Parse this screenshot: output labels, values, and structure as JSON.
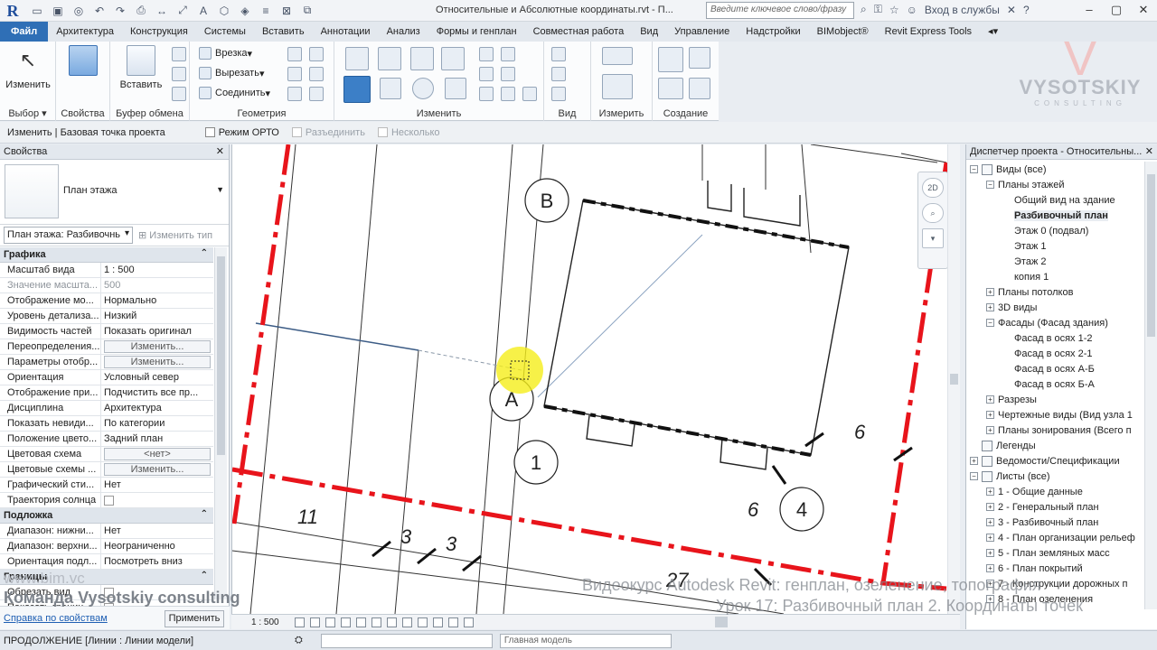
{
  "titlebar": {
    "app_logo": "R",
    "document_title": "Относительные и Абсолютные координаты.rvt - П...",
    "search_placeholder": "Введите ключевое слово/фразу",
    "signin_label": "Вход в службы"
  },
  "ribbon_tabs": [
    "Файл",
    "Архитектура",
    "Конструкция",
    "Системы",
    "Вставить",
    "Аннотации",
    "Анализ",
    "Формы и генплан",
    "Совместная работа",
    "Вид",
    "Управление",
    "Надстройки",
    "BIMobject®",
    "Revit Express Tools"
  ],
  "active_tab_index": 0,
  "ribbon": {
    "select": {
      "button": "Изменить",
      "label": "Выбор"
    },
    "properties": {
      "label": "Свойства"
    },
    "clipboard": {
      "button": "Вставить",
      "label": "Буфер обмена"
    },
    "geometry": {
      "cut": "Врезка",
      "cut_out": "Вырезать",
      "join": "Соединить",
      "label": "Геометрия"
    },
    "modify": {
      "label": "Изменить"
    },
    "view": {
      "label": "Вид"
    },
    "measure": {
      "label": "Измерить"
    },
    "create": {
      "label": "Создание"
    }
  },
  "brand_logo": {
    "mark": "V",
    "name": "VYSOTSKIY",
    "tagline": "CONSULTING"
  },
  "options_bar": {
    "context": "Изменить | Базовая точка проекта",
    "options": [
      {
        "label": "Режим ОРТО",
        "enabled": true
      },
      {
        "label": "Разъединить",
        "enabled": false
      },
      {
        "label": "Несколько",
        "enabled": false
      }
    ]
  },
  "properties": {
    "title": "Свойства",
    "type_name": "План этажа",
    "instance_selector": "План этажа: Разбивочнь",
    "edit_type": "Изменить тип",
    "sections": [
      {
        "name": "Графика",
        "rows": [
          {
            "key": "Масштаб вида",
            "value": "1 : 500",
            "kind": "text"
          },
          {
            "key": "Значение масшта...",
            "value": "500",
            "kind": "dim"
          },
          {
            "key": "Отображение мо...",
            "value": "Нормально",
            "kind": "text"
          },
          {
            "key": "Уровень детализа...",
            "value": "Низкий",
            "kind": "text"
          },
          {
            "key": "Видимость частей",
            "value": "Показать оригинал",
            "kind": "text"
          },
          {
            "key": "Переопределения...",
            "value": "Изменить...",
            "kind": "button"
          },
          {
            "key": "Параметры отобр...",
            "value": "Изменить...",
            "kind": "button"
          },
          {
            "key": "Ориентация",
            "value": "Условный север",
            "kind": "text"
          },
          {
            "key": "Отображение при...",
            "value": "Подчистить все пр...",
            "kind": "text"
          },
          {
            "key": "Дисциплина",
            "value": "Архитектура",
            "kind": "text"
          },
          {
            "key": "Показать невиди...",
            "value": "По категории",
            "kind": "text"
          },
          {
            "key": "Положение цвето...",
            "value": "Задний план",
            "kind": "text"
          },
          {
            "key": "Цветовая схема",
            "value": "<нет>",
            "kind": "button"
          },
          {
            "key": "Цветовые схемы ...",
            "value": "Изменить...",
            "kind": "button"
          },
          {
            "key": "Графический сти...",
            "value": "Нет",
            "kind": "text"
          },
          {
            "key": "Траектория солнца",
            "value": "",
            "kind": "checkbox"
          }
        ]
      },
      {
        "name": "Подложка",
        "rows": [
          {
            "key": "Диапазон: нижни...",
            "value": "Нет",
            "kind": "text"
          },
          {
            "key": "Диапазон: верхни...",
            "value": "Неограниченно",
            "kind": "text"
          },
          {
            "key": "Ориентация подл...",
            "value": "Посмотреть вниз",
            "kind": "text"
          }
        ]
      },
      {
        "name": "Границы",
        "rows": [
          {
            "key": "Обрезать вид",
            "value": "",
            "kind": "checkbox"
          },
          {
            "key": "Показать границ...",
            "value": "",
            "kind": "checkbox"
          }
        ]
      }
    ],
    "help_link": "Справка по свойствам",
    "apply_button": "Применить"
  },
  "canvas": {
    "grid_bubbles": [
      "B",
      "A",
      "1",
      "4"
    ],
    "dimension_labels": [
      "11",
      "3",
      "3",
      "27",
      "6",
      "6"
    ]
  },
  "view_bar": {
    "scale": "1 : 500"
  },
  "browser": {
    "title": "Диспетчер проекта - Относительны...",
    "nodes": [
      {
        "label": "Виды (все)",
        "level": 0,
        "toggle": "-",
        "icon": true
      },
      {
        "label": "Планы этажей",
        "level": 1,
        "toggle": "-"
      },
      {
        "label": "Общий вид на здание",
        "level": 2
      },
      {
        "label": "Разбивочный план",
        "level": 2,
        "selected": true
      },
      {
        "label": "Этаж 0 (подвал)",
        "level": 2
      },
      {
        "label": "Этаж 1",
        "level": 2
      },
      {
        "label": "Этаж 2",
        "level": 2
      },
      {
        "label": "копия 1",
        "level": 2
      },
      {
        "label": "Планы потолков",
        "level": 1,
        "toggle": "+"
      },
      {
        "label": "3D виды",
        "level": 1,
        "toggle": "+"
      },
      {
        "label": "Фасады (Фасад здания)",
        "level": 1,
        "toggle": "-"
      },
      {
        "label": "Фасад в осях 1-2",
        "level": 2
      },
      {
        "label": "Фасад в осях 2-1",
        "level": 2
      },
      {
        "label": "Фасад в осях А-Б",
        "level": 2
      },
      {
        "label": "Фасад в осях Б-А",
        "level": 2
      },
      {
        "label": "Разрезы",
        "level": 1,
        "toggle": "+"
      },
      {
        "label": "Чертежные виды (Вид узла 1",
        "level": 1,
        "toggle": "+"
      },
      {
        "label": "Планы зонирования (Всего п",
        "level": 1,
        "toggle": "+"
      },
      {
        "label": "Легенды",
        "level": 0,
        "icon": true
      },
      {
        "label": "Ведомости/Спецификации",
        "level": 0,
        "toggle": "+",
        "icon": true
      },
      {
        "label": "Листы (все)",
        "level": 0,
        "toggle": "-",
        "icon": true
      },
      {
        "label": "1 - Общие данные",
        "level": 1,
        "toggle": "+"
      },
      {
        "label": "2 - Генеральный план",
        "level": 1,
        "toggle": "+"
      },
      {
        "label": "3 - Разбивочный план",
        "level": 1,
        "toggle": "+"
      },
      {
        "label": "4 - План организации рельеф",
        "level": 1,
        "toggle": "+"
      },
      {
        "label": "5 - План земляных масс",
        "level": 1,
        "toggle": "+"
      },
      {
        "label": "6 - План покрытий",
        "level": 1,
        "toggle": "+"
      },
      {
        "label": "7 - Конструкции дорожных п",
        "level": 1,
        "toggle": "+"
      },
      {
        "label": "8 - План озеленения",
        "level": 1,
        "toggle": "+"
      }
    ]
  },
  "status_bar": {
    "message": "ПРОДОЛЖЕНИЕ [Линии : Линии модели]",
    "model": "Главная модель"
  },
  "watermarks": {
    "site": "www.bim.vc",
    "team": "Команда Vysotskiy consulting",
    "course": "Видеокурс Autodesk Revit: генплан, озеленение, топография",
    "lesson": "Урок 17: Разбивочный план 2. Координаты точек"
  },
  "colors": {
    "boundary_red": "#e8141b",
    "file_tab_blue": "#2f6fb6",
    "highlight_yellow": "#f5ee1a"
  }
}
